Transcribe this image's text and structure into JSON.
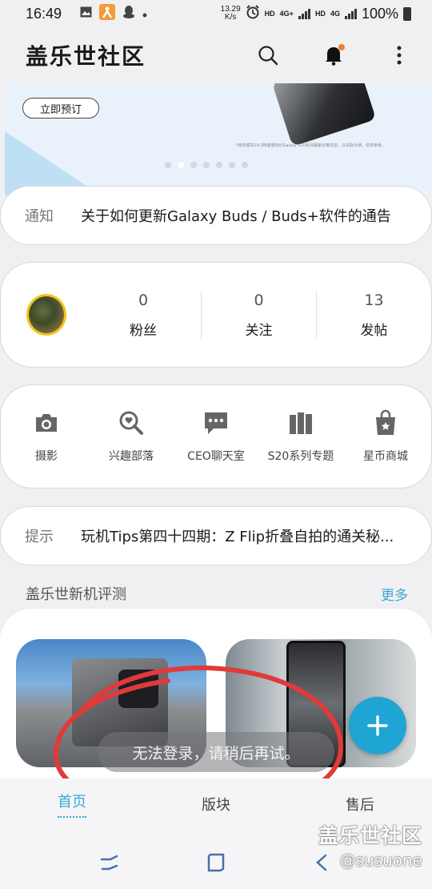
{
  "status_bar": {
    "time": "16:49",
    "net_speed_value": "13.29",
    "net_speed_unit": "K/s",
    "hd1": "HD",
    "lte1": "4G+",
    "hd2": "HD",
    "lte2": "4G",
    "battery": "100%"
  },
  "header": {
    "title": "盖乐世社区",
    "icons": [
      "search-icon",
      "bell-icon",
      "more-vert-icon"
    ],
    "accent": "#f07a2d"
  },
  "banner": {
    "button_label": "立即预订",
    "note": "*商务模块19.2档套装特价Galaxy S20系列最新价格信息，以实际为准，仅供参考。",
    "slide_count": 7,
    "active_slide": 2
  },
  "notice": {
    "tag": "通知",
    "text": "关于如何更新Galaxy Buds / Buds+软件的通告"
  },
  "profile": {
    "stats": [
      {
        "value": "0",
        "label": "粉丝"
      },
      {
        "value": "0",
        "label": "关注"
      },
      {
        "value": "13",
        "label": "发帖"
      }
    ]
  },
  "features": [
    {
      "label": "摄影",
      "icon": "camera-icon"
    },
    {
      "label": "兴趣部落",
      "icon": "interest-icon"
    },
    {
      "label": "CEO聊天室",
      "icon": "chat-icon"
    },
    {
      "label": "S20系列专题",
      "icon": "books-icon"
    },
    {
      "label": "星币商城",
      "icon": "shopping-bag-icon"
    }
  ],
  "tip": {
    "tag": "提示",
    "text": "玩机Tips第四十四期：Z Flip折叠自拍的通关秘..."
  },
  "reviews": {
    "title": "盖乐世新机评测",
    "more": "更多",
    "accent": "#39a8d6"
  },
  "toast": "无法登录，请稍后再试。",
  "tabs": [
    {
      "label": "首页",
      "active": true
    },
    {
      "label": "版块",
      "active": false
    },
    {
      "label": "售后",
      "active": false
    }
  ],
  "watermark": {
    "title": "盖乐世社区",
    "user": "@susuone"
  }
}
